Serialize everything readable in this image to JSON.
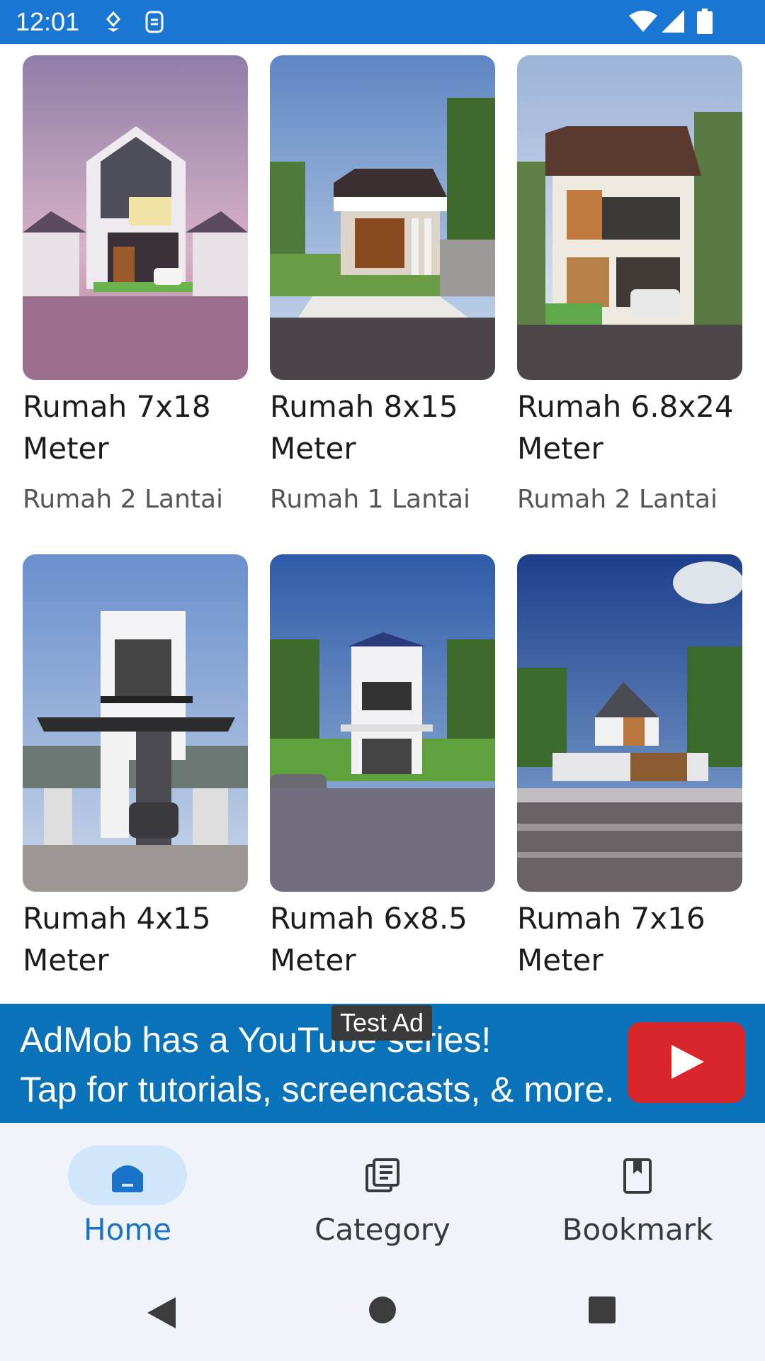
{
  "status_bar": {
    "time": "12:01",
    "color": "#1976d2",
    "icons": [
      "location-icon",
      "sim-icon",
      "wifi-icon",
      "signal-icon",
      "battery-icon"
    ]
  },
  "cards": [
    {
      "title_line1": "Rumah 7x18",
      "title_line2": "Meter",
      "subtitle": "Rumah 2 Lantai"
    },
    {
      "title_line1": "Rumah 8x15",
      "title_line2": "Meter",
      "subtitle": "Rumah 1 Lantai"
    },
    {
      "title_line1": "Rumah 6.8x24",
      "title_line2": "Meter",
      "subtitle": "Rumah 2 Lantai"
    },
    {
      "title_line1": "Rumah 4x15",
      "title_line2": "Meter",
      "subtitle": ""
    },
    {
      "title_line1": "Rumah 6x8.5",
      "title_line2": "Meter",
      "subtitle": ""
    },
    {
      "title_line1": "Rumah 7x16",
      "title_line2": "Meter",
      "subtitle": ""
    }
  ],
  "ad": {
    "badge": "Test Ad",
    "line1": "AdMob has a YouTube series!",
    "line2": "Tap for tutorials, screencasts, & more."
  },
  "bottom_nav": {
    "items": [
      {
        "label": "Home",
        "icon": "home-icon",
        "active": true
      },
      {
        "label": "Category",
        "icon": "category-icon",
        "active": false
      },
      {
        "label": "Bookmark",
        "icon": "bookmark-icon",
        "active": false
      }
    ],
    "accent": "#1a73c9"
  },
  "system_nav": [
    "back-icon",
    "home-circle-icon",
    "recents-icon"
  ]
}
